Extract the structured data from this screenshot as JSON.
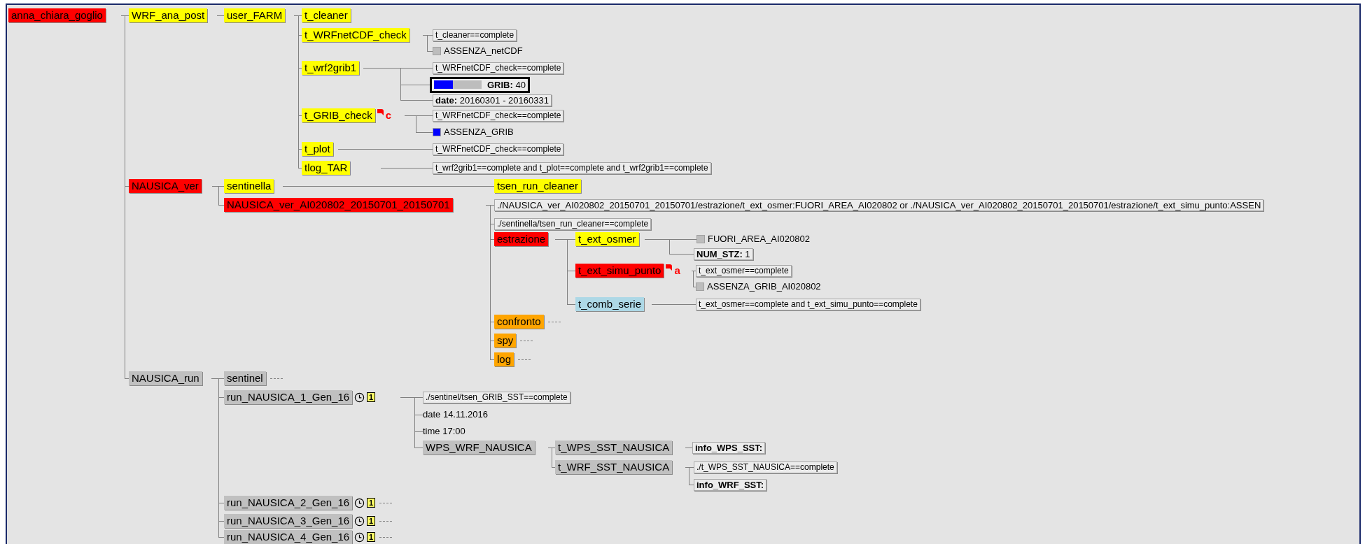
{
  "tree": [
    {
      "name": "anna_chiara_goglio",
      "color": "#ff0000",
      "collapsed": false,
      "children": [
        {
          "name": "WRF_ana_post",
          "color": "#ffff00",
          "collapsed": false,
          "children": [
            {
              "name": "user_FARM",
              "color": "#ffff00",
              "collapsed": false,
              "children": [
                {
                  "name": "t_cleaner",
                  "color": "#ffff00",
                  "collapsed": false
                },
                {
                  "name": "t_WRFnetCDF_check",
                  "color": "#ffff00",
                  "collapsed": false,
                  "attributes": [
                    {
                      "kind": "trigger",
                      "text": "t_cleaner==complete"
                    },
                    {
                      "kind": "event",
                      "text": "ASSENZA_netCDF",
                      "set": false
                    }
                  ]
                },
                {
                  "name": "t_wrf2grib1",
                  "color": "#ffff00",
                  "collapsed": false,
                  "attributes": [
                    {
                      "kind": "trigger",
                      "text": "t_WRFnetCDF_check==complete"
                    },
                    {
                      "kind": "meter",
                      "name": "GRIB:",
                      "value": "40",
                      "level": 0.39
                    },
                    {
                      "kind": "repeat",
                      "name": "date:",
                      "value": "20160301 - 20160331"
                    }
                  ]
                },
                {
                  "name": "t_GRIB_check",
                  "color": "#ffff00",
                  "collapsed": false,
                  "flag": "c",
                  "attributes": [
                    {
                      "kind": "trigger",
                      "text": "t_WRFnetCDF_check==complete"
                    },
                    {
                      "kind": "event",
                      "text": "ASSENZA_GRIB",
                      "set": true
                    }
                  ]
                },
                {
                  "name": "t_plot",
                  "color": "#ffff00",
                  "collapsed": false,
                  "attributes": [
                    {
                      "kind": "trigger",
                      "text": "t_WRFnetCDF_check==complete"
                    }
                  ]
                },
                {
                  "name": "tlog_TAR",
                  "color": "#ffff00",
                  "collapsed": false,
                  "attributes": [
                    {
                      "kind": "trigger",
                      "text": "t_wrf2grib1==complete and t_plot==complete and t_wrf2grib1==complete"
                    }
                  ]
                }
              ]
            }
          ]
        },
        {
          "name": "NAUSICA_ver",
          "color": "#ff0000",
          "collapsed": false,
          "children": [
            {
              "name": "sentinella",
              "color": "#ffff00",
              "collapsed": false,
              "children": [
                {
                  "name": "tsen_run_cleaner",
                  "color": "#ffff00",
                  "collapsed": false
                }
              ]
            },
            {
              "name": "NAUSICA_ver_AI020802_20150701_20150701",
              "color": "#ff0000",
              "collapsed": false,
              "attributes": [
                {
                  "kind": "complex_trigger",
                  "text": "./NAUSICA_ver_AI020802_20150701_20150701/estrazione/t_ext_osmer:FUORI_AREA_AI020802 or ./NAUSICA_ver_AI020802_20150701_20150701/estrazione/t_ext_simu_punto:ASSEN"
                },
                {
                  "kind": "trigger",
                  "text": "./sentinella/tsen_run_cleaner==complete"
                }
              ],
              "children": [
                {
                  "name": "estrazione",
                  "color": "#ff0000",
                  "collapsed": false,
                  "children": [
                    {
                      "name": "t_ext_osmer",
                      "color": "#ffff00",
                      "collapsed": false,
                      "attributes": [
                        {
                          "kind": "event",
                          "text": "FUORI_AREA_AI020802",
                          "set": false
                        },
                        {
                          "kind": "variable",
                          "name": "NUM_STZ:",
                          "value": "1"
                        }
                      ]
                    },
                    {
                      "name": "t_ext_simu_punto",
                      "color": "#ff0000",
                      "collapsed": false,
                      "flag": "a",
                      "attributes": [
                        {
                          "kind": "trigger",
                          "text": "t_ext_osmer==complete"
                        },
                        {
                          "kind": "event",
                          "text": "ASSENZA_GRIB_AI020802",
                          "set": false
                        }
                      ]
                    },
                    {
                      "name": "t_comb_serie",
                      "color": "#add8e6",
                      "collapsed": false,
                      "attributes": [
                        {
                          "kind": "trigger",
                          "text": "t_ext_osmer==complete and t_ext_simu_punto==complete"
                        }
                      ]
                    }
                  ]
                },
                {
                  "name": "confronto",
                  "color": "#ffa500",
                  "collapsed": true
                },
                {
                  "name": "spy",
                  "color": "#ffa500",
                  "collapsed": true
                },
                {
                  "name": "log",
                  "color": "#ffa500",
                  "collapsed": true
                }
              ]
            }
          ]
        },
        {
          "name": "NAUSICA_run",
          "color": "#c0c0c0",
          "collapsed": false,
          "children": [
            {
              "name": "sentinel",
              "color": "#c0c0c0",
              "collapsed": true
            },
            {
              "name": "run_NAUSICA_1_Gen_16",
              "color": "#c0c0c0",
              "collapsed": false,
              "badge": "1",
              "attributes": [
                {
                  "kind": "trigger",
                  "text": "./sentinel/tsen_GRIB_SST==complete"
                },
                {
                  "kind": "time",
                  "text": "date 14.11.2016"
                },
                {
                  "kind": "time",
                  "text": "time 17:00"
                }
              ],
              "children": [
                {
                  "name": "WPS_WRF_NAUSICA",
                  "color": "#c0c0c0",
                  "collapsed": false,
                  "children": [
                    {
                      "name": "t_WPS_SST_NAUSICA",
                      "color": "#c0c0c0",
                      "collapsed": false,
                      "attributes": [
                        {
                          "kind": "label",
                          "name": "info_WPS_SST:"
                        }
                      ]
                    },
                    {
                      "name": "t_WRF_SST_NAUSICA",
                      "color": "#c0c0c0",
                      "collapsed": false,
                      "attributes": [
                        {
                          "kind": "trigger",
                          "text": "./t_WPS_SST_NAUSICA==complete"
                        },
                        {
                          "kind": "label",
                          "name": "info_WRF_SST:"
                        }
                      ]
                    }
                  ]
                }
              ]
            },
            {
              "name": "run_NAUSICA_2_Gen_16",
              "color": "#c0c0c0",
              "collapsed": true,
              "badge": "1"
            },
            {
              "name": "run_NAUSICA_3_Gen_16",
              "color": "#c0c0c0",
              "collapsed": true,
              "badge": "1"
            },
            {
              "name": "run_NAUSICA_4_Gen_16",
              "color": "#c0c0c0",
              "collapsed": true,
              "badge": "1"
            }
          ]
        }
      ]
    }
  ]
}
